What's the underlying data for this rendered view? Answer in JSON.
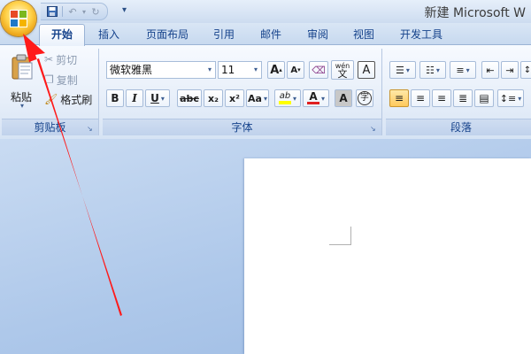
{
  "window": {
    "title": "新建 Microsoft W"
  },
  "quick_access": {
    "more": "▾"
  },
  "tabs": [
    {
      "label": "开始"
    },
    {
      "label": "插入"
    },
    {
      "label": "页面布局"
    },
    {
      "label": "引用"
    },
    {
      "label": "邮件"
    },
    {
      "label": "审阅"
    },
    {
      "label": "视图"
    },
    {
      "label": "开发工具"
    }
  ],
  "clipboard": {
    "paste": "粘贴",
    "cut": "剪切",
    "copy": "复制",
    "format_painter": "格式刷",
    "group_label": "剪贴板"
  },
  "font": {
    "name": "微软雅黑",
    "size": "11",
    "grow": "A",
    "shrink": "A",
    "phonetic": "wén",
    "phonetic_char": "文",
    "border_char": "A",
    "bold": "B",
    "italic": "I",
    "underline": "U",
    "strike": "abc",
    "subscript": "x₂",
    "superscript": "x²",
    "change_case": "Aa",
    "highlight": "ab",
    "font_color": "A",
    "shading": "A",
    "enclose": "字",
    "group_label": "字体"
  },
  "paragraph": {
    "group_label": "段落"
  },
  "colors": {
    "highlight": "#ffff00",
    "font_color": "#e02020",
    "arrow": "#ff1a1a"
  }
}
